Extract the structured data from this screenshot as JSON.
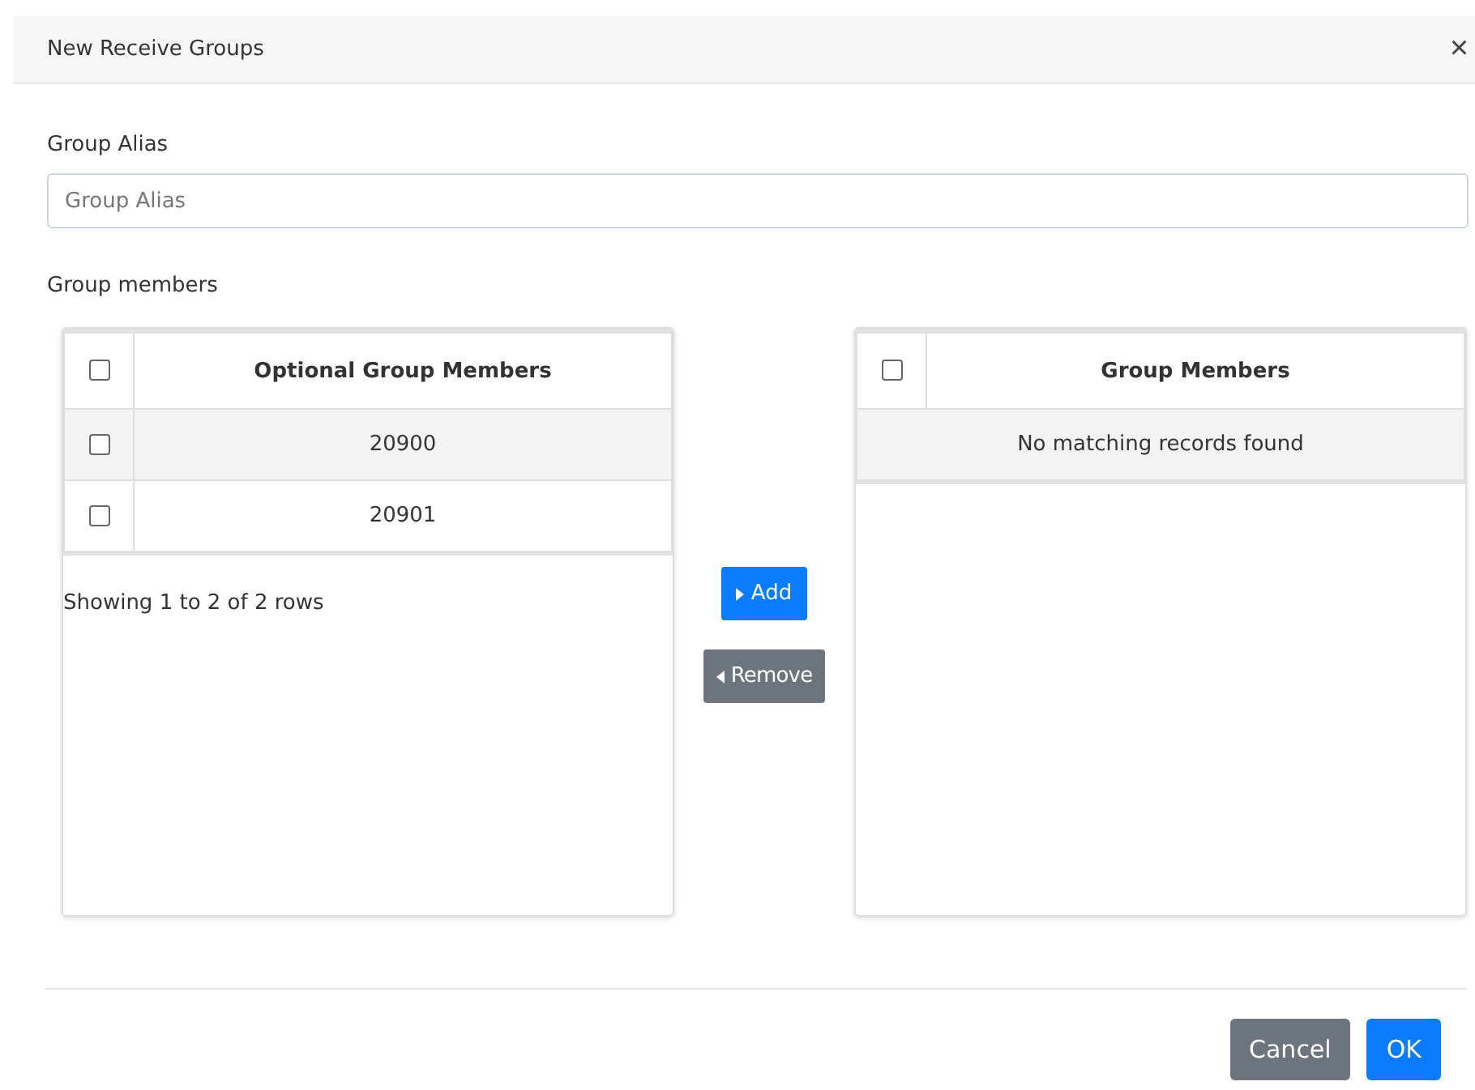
{
  "dialog": {
    "title": "New Receive Groups",
    "close": "×"
  },
  "alias": {
    "label": "Group Alias",
    "placeholder": "Group Alias"
  },
  "members_label": "Group members",
  "optional_table": {
    "header": "Optional Group Members",
    "header_checked": false,
    "rows": [
      {
        "value": "20900",
        "checked": false
      },
      {
        "value": "20901",
        "checked": false
      }
    ],
    "footer": "Showing 1 to 2 of 2 rows"
  },
  "transfer_buttons": [
    {
      "label": "Add",
      "kind": "add"
    },
    {
      "label": "Remove",
      "kind": "remove"
    }
  ],
  "members_table": {
    "header": "Group Members",
    "header_checked": false,
    "empty": "No matching records found"
  },
  "footer_buttons": [
    {
      "label": "Cancel",
      "kind": "secondary"
    },
    {
      "label": "OK",
      "kind": "primary"
    }
  ]
}
